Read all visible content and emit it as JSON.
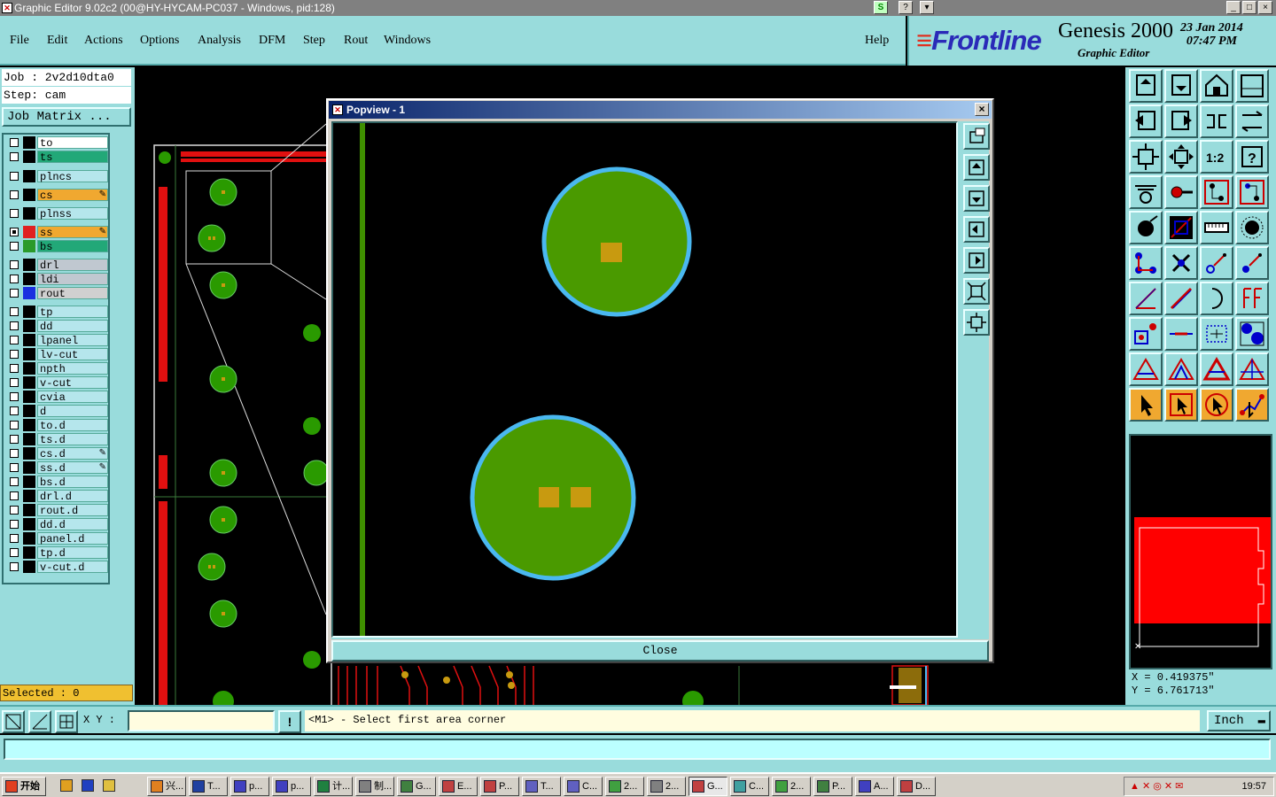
{
  "window": {
    "title": "Graphic Editor 9.02c2 (00@HY-HYCAM-PC037 - Windows, pid:128)",
    "buttons": [
      "_",
      "□",
      "×"
    ],
    "toolbar_extra": [
      "S",
      "?",
      "▾"
    ]
  },
  "menu": [
    "File",
    "Edit",
    "Actions",
    "Options",
    "Analysis",
    "DFM",
    "Step",
    "Rout",
    "Windows"
  ],
  "help_label": "Help",
  "brand": {
    "logo": "Frontline",
    "product": "Genesis 2000",
    "subtitle": "Graphic Editor",
    "date": "23  Jan  2014",
    "time": "07:47  PM"
  },
  "job": {
    "job_line": "Job : 2v2d10dta0",
    "step_line": "Step: cam",
    "matrix_button": "Job Matrix ..."
  },
  "layers": [
    {
      "name": "to",
      "bg": "#ffffff"
    },
    {
      "name": "ts",
      "bg": "#22a878"
    },
    {
      "name": "plncs",
      "bg": "#b5e6ec"
    },
    {
      "name": "cs",
      "bg": "#f0a830",
      "mark": true
    },
    {
      "name": "plnss",
      "bg": "#b5e6ec"
    },
    {
      "name": "ss",
      "bg": "#f0a830",
      "swatch": "#e02020",
      "active": true,
      "mark": true
    },
    {
      "name": "bs",
      "bg": "#22a878",
      "swatch": "#2a9a2a"
    },
    {
      "name": "drl",
      "bg": "#c0c8d0"
    },
    {
      "name": "ldi",
      "bg": "#c0c8d0"
    },
    {
      "name": "rout",
      "bg": "#d0d0d0",
      "swatch": "#1a30e0"
    },
    {
      "name": "tp",
      "bg": "#b5e6ec"
    },
    {
      "name": "dd",
      "bg": "#b5e6ec"
    },
    {
      "name": "lpanel",
      "bg": "#b5e6ec"
    },
    {
      "name": "lv-cut",
      "bg": "#b5e6ec"
    },
    {
      "name": "npth",
      "bg": "#b5e6ec"
    },
    {
      "name": "v-cut",
      "bg": "#b5e6ec"
    },
    {
      "name": "cvia",
      "bg": "#b5e6ec"
    },
    {
      "name": "d",
      "bg": "#b5e6ec"
    },
    {
      "name": "to.d",
      "bg": "#b5e6ec"
    },
    {
      "name": "ts.d",
      "bg": "#b5e6ec"
    },
    {
      "name": "cs.d",
      "bg": "#b5e6ec",
      "mark": true
    },
    {
      "name": "ss.d",
      "bg": "#b5e6ec",
      "mark": true
    },
    {
      "name": "bs.d",
      "bg": "#b5e6ec"
    },
    {
      "name": "drl.d",
      "bg": "#b5e6ec"
    },
    {
      "name": "rout.d",
      "bg": "#b5e6ec"
    },
    {
      "name": "dd.d",
      "bg": "#b5e6ec"
    },
    {
      "name": "panel.d",
      "bg": "#b5e6ec"
    },
    {
      "name": "tp.d",
      "bg": "#b5e6ec"
    },
    {
      "name": "v-cut.d",
      "bg": "#b5e6ec"
    }
  ],
  "selected_text": "Selected : 0",
  "popview": {
    "title": "Popview - 1",
    "close_label": "Close"
  },
  "coords": {
    "x": "X  =  0.419375\"",
    "y": "Y  =  6.761713\""
  },
  "xy_label": "X Y :",
  "prompt": "<M1> - Select first area corner",
  "units": "Inch",
  "status_text": "",
  "colors": {
    "panel": "#99dcdc",
    "copper": "#4a9a00",
    "pad_ring": "#4ab8f0",
    "pad_fill": "#c89a10",
    "minimap_fill": "#ff0000"
  },
  "taskbar": {
    "start": "开始",
    "items": [
      "兴...",
      "T...",
      "p...",
      "p...",
      "计...",
      "制...",
      "G...",
      "E...",
      "P...",
      "T...",
      "C...",
      "2...",
      "2...",
      "G...",
      "C...",
      "2...",
      "P...",
      "A...",
      "D..."
    ],
    "clock": "19:57"
  }
}
